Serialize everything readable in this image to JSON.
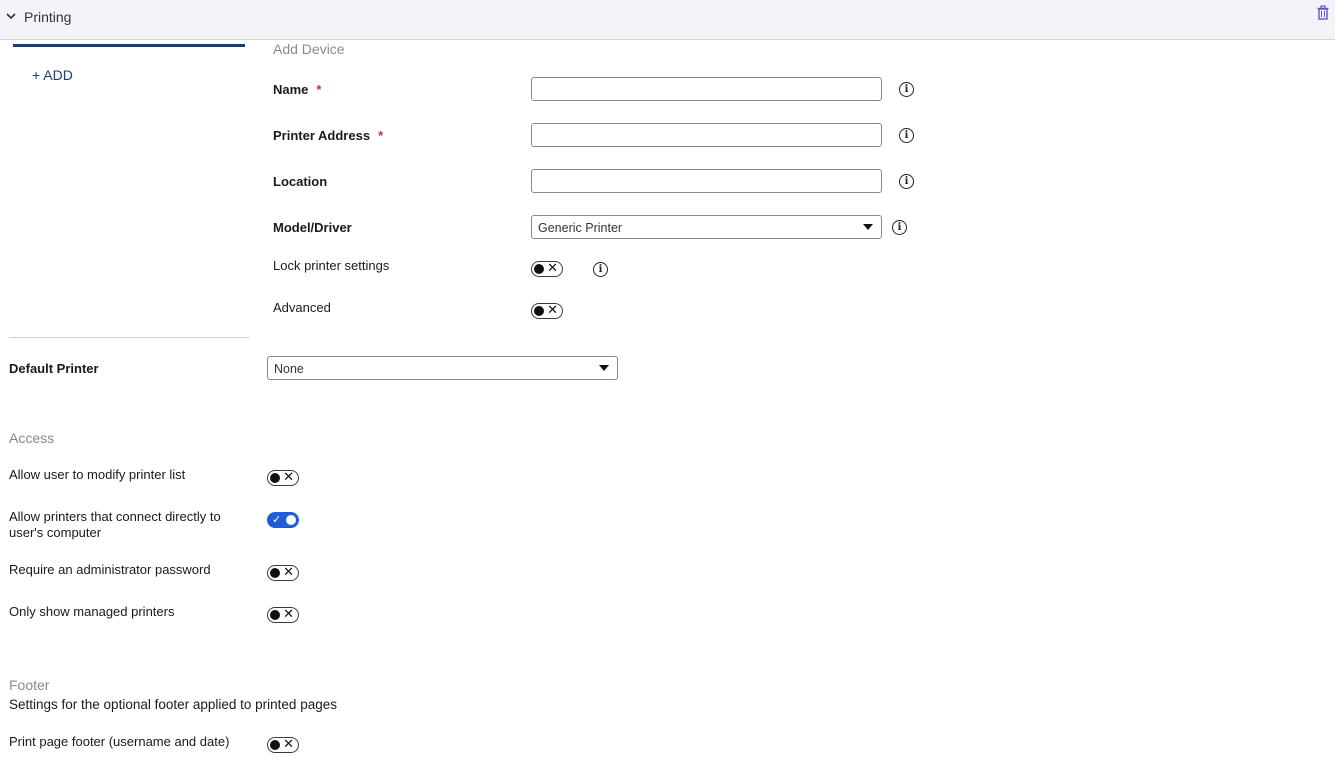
{
  "header": {
    "title": "Printing"
  },
  "printers": {
    "add_label": "+ ADD"
  },
  "add_device": {
    "title": "Add Device",
    "name_label": "Name",
    "name_value": "",
    "address_label": "Printer Address",
    "address_value": "",
    "location_label": "Location",
    "location_value": "",
    "model_label": "Model/Driver",
    "model_value": "Generic Printer",
    "lock_label": "Lock printer settings",
    "advanced_label": "Advanced",
    "required_mark": "*"
  },
  "default_printer": {
    "label": "Default Printer",
    "value": "None"
  },
  "access": {
    "title": "Access",
    "modify_list_label": "Allow user to modify printer list",
    "direct_connect_label": "Allow printers that connect directly to user's computer",
    "admin_password_label": "Require an administrator password",
    "managed_only_label": "Only show managed printers"
  },
  "footer": {
    "title": "Footer",
    "description": "Settings for the optional footer applied to printed pages",
    "print_footer_label": "Print page footer (username and date)"
  },
  "toggles": {
    "off_mark": "✕",
    "on_mark": "✓"
  },
  "colors": {
    "accent": "#1f5fd6",
    "tab_underline": "#1c3d6e",
    "required": "#c0392b"
  }
}
